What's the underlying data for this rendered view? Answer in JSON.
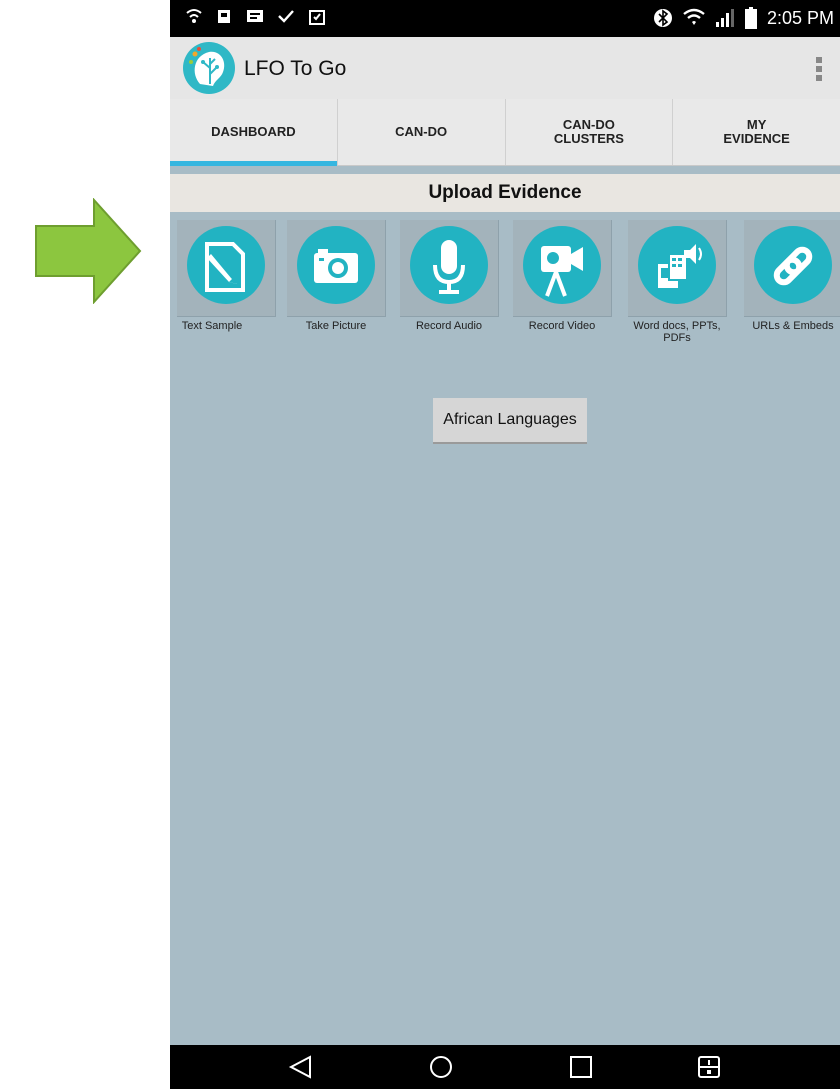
{
  "status": {
    "time": "2:05 PM",
    "left_icons": [
      "wifi-signal-icon",
      "security-icon",
      "message-icon",
      "check-icon",
      "clipboard-icon"
    ],
    "right_icons": [
      "bluetooth-icon",
      "wifi-icon",
      "signal-icon",
      "battery-icon"
    ]
  },
  "app": {
    "title": "LFO To Go"
  },
  "tabs": [
    {
      "label": "DASHBOARD",
      "active": true
    },
    {
      "label": "CAN-DO",
      "active": false
    },
    {
      "label": "CAN-DO CLUSTERS",
      "active": false
    },
    {
      "label": "MY EVIDENCE",
      "active": false
    }
  ],
  "upload": {
    "title": "Upload Evidence",
    "items": [
      {
        "label": "Text Sample",
        "icon": "text-sample-icon"
      },
      {
        "label": "Take Picture",
        "icon": "camera-icon"
      },
      {
        "label": "Record Audio",
        "icon": "microphone-icon"
      },
      {
        "label": "Record Video",
        "icon": "video-camera-icon"
      },
      {
        "label": "Word docs, PPTs, PDFs",
        "icon": "documents-icon"
      },
      {
        "label": "URLs & Embeds",
        "icon": "link-icon"
      }
    ]
  },
  "language_button": "African Languages",
  "colors": {
    "accent": "#35b6e0",
    "icon_circle": "#22b3c2",
    "arrow": "#8cc63f",
    "background": "#a8bcc6"
  }
}
